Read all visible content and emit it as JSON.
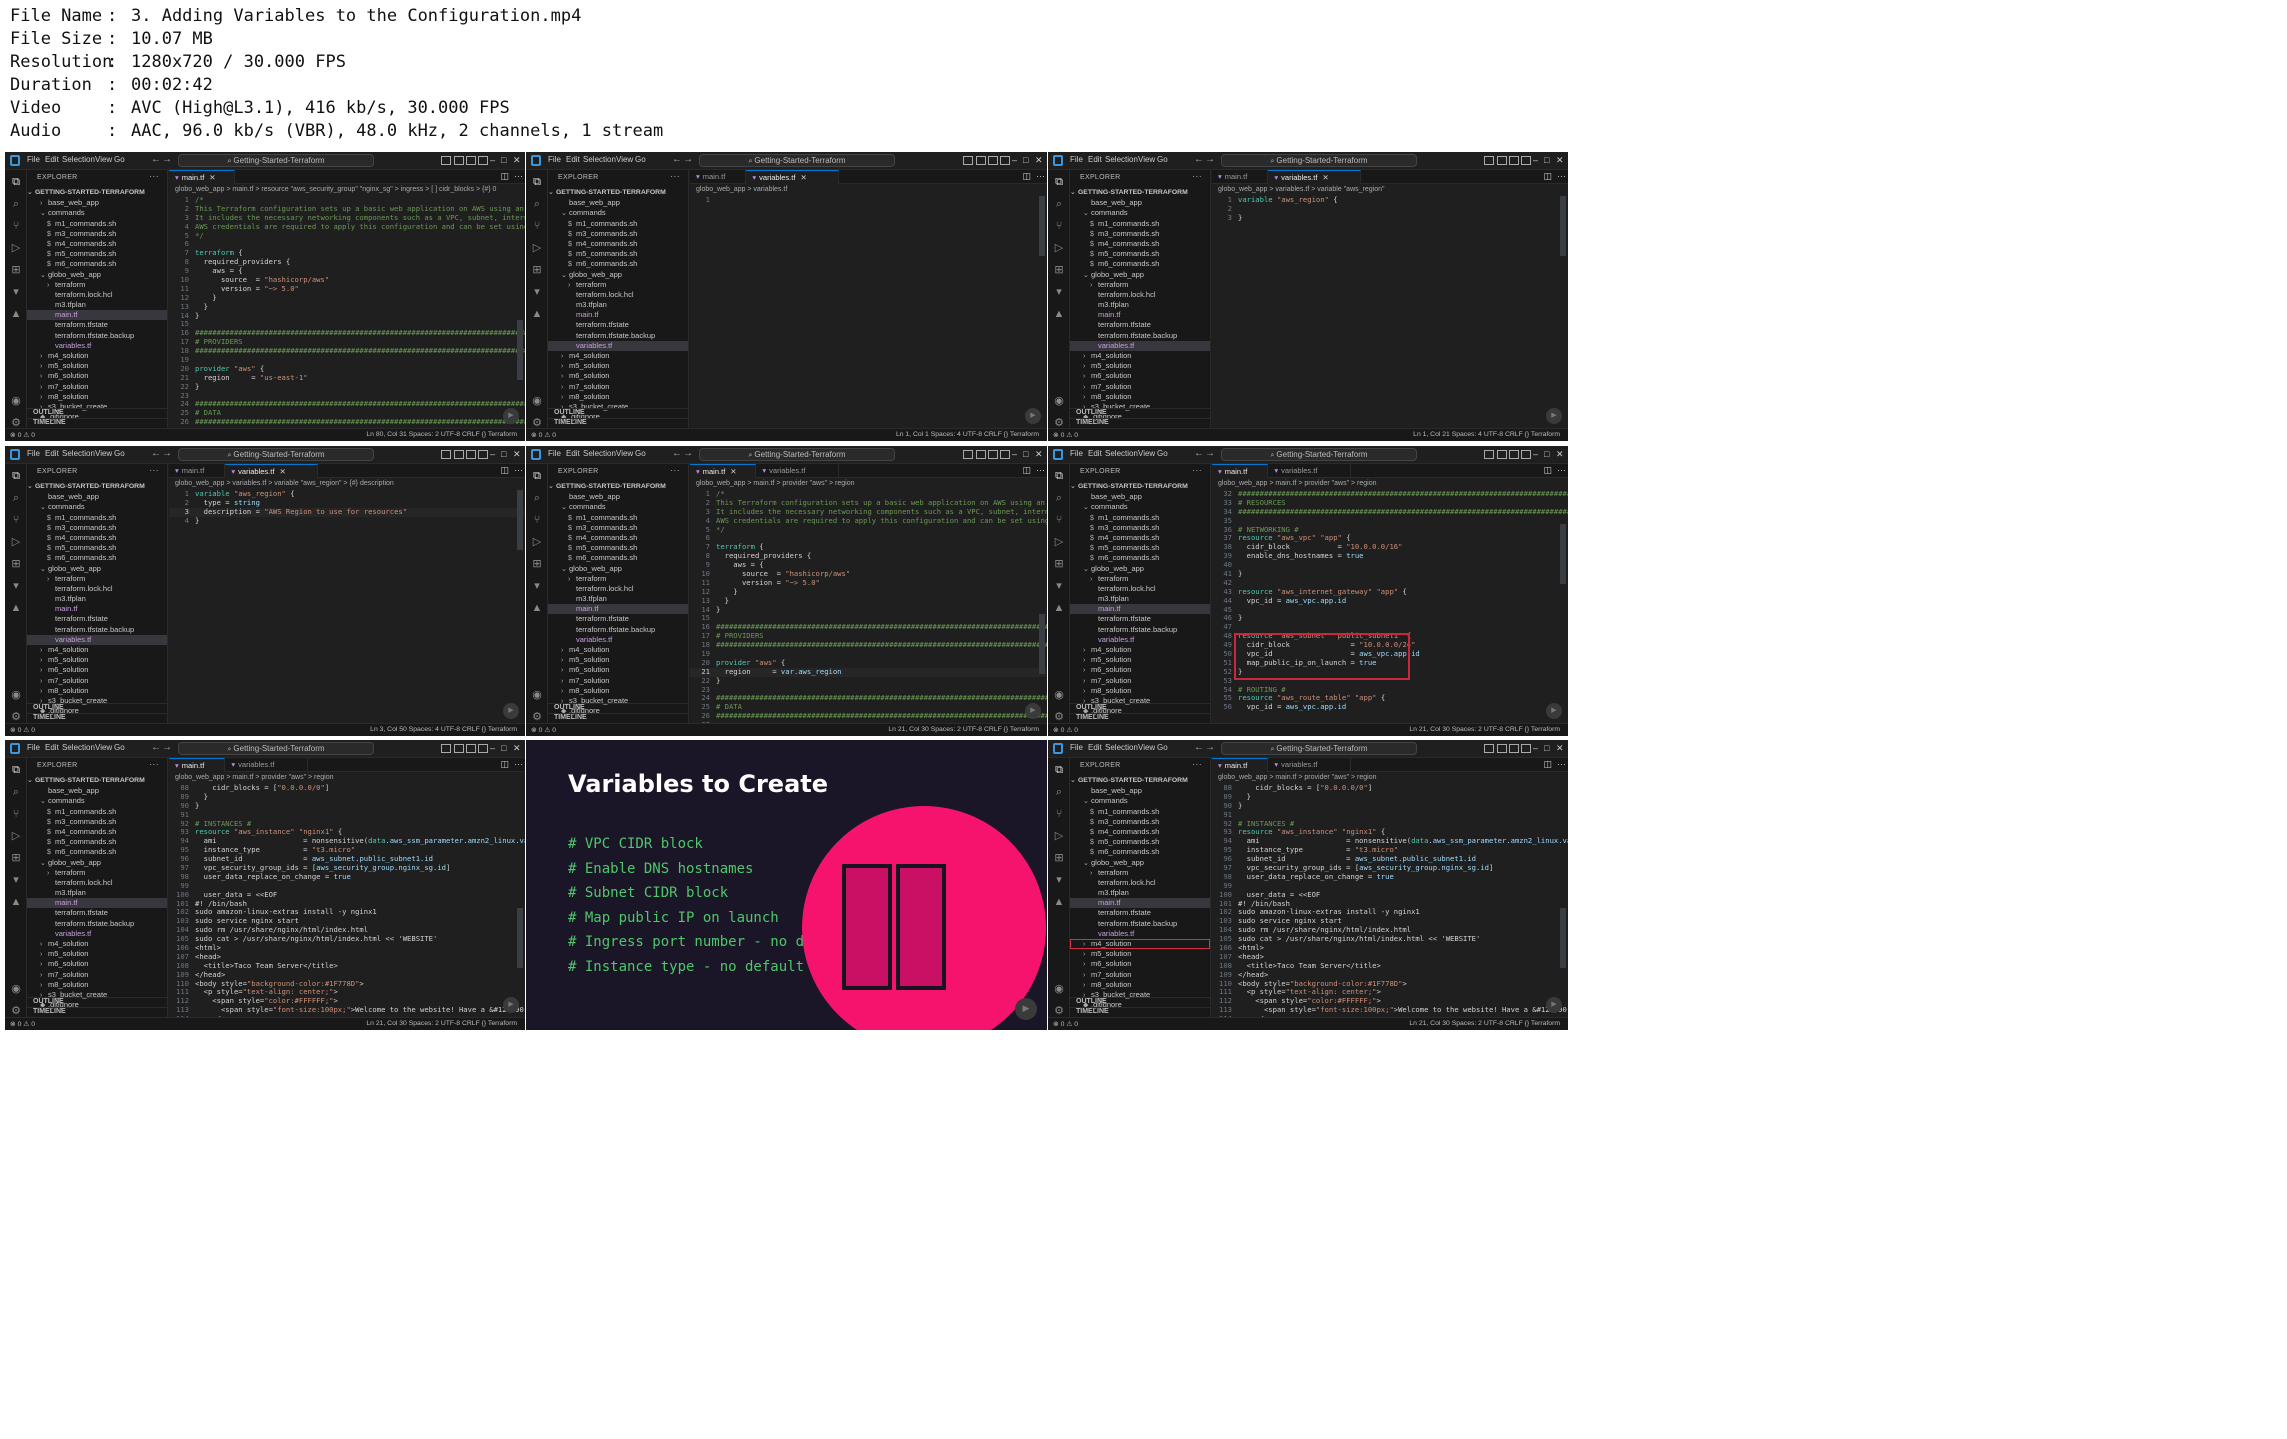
{
  "meta": [
    {
      "key": "File Name",
      "value": "3. Adding Variables to the Configuration.mp4"
    },
    {
      "key": "File Size",
      "value": "10.07 MB"
    },
    {
      "key": "Resolution",
      "value": "1280x720 / 30.000 FPS"
    },
    {
      "key": "Duration",
      "value": "00:02:42"
    },
    {
      "key": "Video",
      "value": "AVC (High@L3.1), 416 kb/s, 30.000 FPS"
    },
    {
      "key": "Audio",
      "value": "AAC, 96.0 kb/s (VBR), 48.0 kHz, 2 channels, 1 stream"
    }
  ],
  "ui": {
    "menu": [
      "File",
      "Edit",
      "Selection",
      "View",
      "Go"
    ],
    "search": "Getting-Started-Terraform",
    "explorer": "EXPLORER",
    "root": "GETTING-STARTED-TERRAFORM",
    "outline": "OUTLINE",
    "timeline": "TIMELINE"
  },
  "colors": {
    "accent": "#0078d4",
    "pink": "#f5136e",
    "highlight": "#c8283c",
    "slide_bg": "#1a1628",
    "slide_code": "#4fc66a"
  },
  "frames": [
    {
      "tabs": [
        {
          "label": "main.tf",
          "active": true,
          "close": true
        }
      ],
      "breadcrumb": "globo_web_app > main.tf > resource \"aws_security_group\" \"nginx_sg\" > ingress > [ ] cidr_blocks > {#} 0",
      "tree_top": "base_web_app",
      "tree_top_chev": "›",
      "tree_state": "main",
      "lines": [
        {
          "n": "1",
          "t": "/*"
        },
        {
          "n": "2",
          "t": "This Terraform configuration sets up a basic web application on AWS using an EC2 instance"
        },
        {
          "n": "3",
          "t": "It includes the necessary networking components such as a VPC, subnet, internet gateway, a"
        },
        {
          "n": "4",
          "t": "AWS credentials are required to apply this configuration and can be set using environment"
        },
        {
          "n": "5",
          "t": "*/"
        },
        {
          "n": "6",
          "t": ""
        },
        {
          "n": "7",
          "t": "terraform {"
        },
        {
          "n": "8",
          "t": "  required_providers {"
        },
        {
          "n": "9",
          "t": "    aws = {"
        },
        {
          "n": "10",
          "t": "      source  = \"hashicorp/aws\""
        },
        {
          "n": "11",
          "t": "      version = \"~> 5.0\""
        },
        {
          "n": "12",
          "t": "    }"
        },
        {
          "n": "13",
          "t": "  }"
        },
        {
          "n": "14",
          "t": "}"
        },
        {
          "n": "15",
          "t": ""
        },
        {
          "n": "16",
          "t": "##################################################################################"
        },
        {
          "n": "17",
          "t": "# PROVIDERS"
        },
        {
          "n": "18",
          "t": "##################################################################################"
        },
        {
          "n": "19",
          "t": ""
        },
        {
          "n": "20",
          "t": "provider \"aws\" {"
        },
        {
          "n": "21",
          "t": "  region     = \"us-east-1\""
        },
        {
          "n": "22",
          "t": "}"
        },
        {
          "n": "23",
          "t": ""
        },
        {
          "n": "24",
          "t": "##################################################################################"
        },
        {
          "n": "25",
          "t": "# DATA"
        },
        {
          "n": "26",
          "t": "##################################################################################"
        }
      ],
      "status": "Ln 80, Col 31   Spaces: 2   UTF-8   CRLF   {} Terraform"
    },
    {
      "tabs": [
        {
          "label": "main.tf",
          "active": false,
          "close": false
        },
        {
          "label": "variables.tf",
          "active": true,
          "close": true
        }
      ],
      "breadcrumb": "globo_web_app > variables.tf",
      "tree_top": "base_web_app",
      "tree_top_chev": "",
      "tree_state": "variables",
      "lines": [
        {
          "n": "1",
          "t": ""
        }
      ],
      "status": "Ln 1, Col 1   Spaces: 4   UTF-8   CRLF   {} Terraform"
    },
    {
      "tabs": [
        {
          "label": "main.tf",
          "active": false,
          "close": false
        },
        {
          "label": "variables.tf",
          "active": true,
          "close": true
        }
      ],
      "breadcrumb": "globo_web_app > variables.tf > variable \"aws_region\"",
      "tree_top": "base_web_app",
      "tree_top_chev": "",
      "tree_state": "variables",
      "lines": [
        {
          "n": "1",
          "t": "variable \"aws_region\" {"
        },
        {
          "n": "2",
          "t": ""
        },
        {
          "n": "3",
          "t": "}"
        }
      ],
      "status": "Ln 1, Col 21   Spaces: 4   UTF-8   CRLF   {} Terraform"
    },
    {
      "tabs": [
        {
          "label": "main.tf",
          "active": false,
          "close": false
        },
        {
          "label": "variables.tf",
          "active": true,
          "close": true
        }
      ],
      "breadcrumb": "globo_web_app > variables.tf > variable \"aws_region\" > {#} description",
      "tree_top": "base_web_app",
      "tree_top_chev": "",
      "tree_state": "variables",
      "lines": [
        {
          "n": "1",
          "t": "variable \"aws_region\" {"
        },
        {
          "n": "2",
          "t": "  type = string"
        },
        {
          "n": "3",
          "t": "  description = \"AWS Region to use for resources\""
        },
        {
          "n": "4",
          "t": "}"
        }
      ],
      "status": "Ln 3, Col 50   Spaces: 4   UTF-8   CRLF   {} Terraform"
    },
    {
      "tabs": [
        {
          "label": "main.tf",
          "active": true,
          "close": true
        },
        {
          "label": "variables.tf",
          "active": false,
          "close": false
        }
      ],
      "breadcrumb": "globo_web_app > main.tf > provider \"aws\" > region",
      "tree_top": "base_web_app",
      "tree_top_chev": "",
      "tree_state": "main",
      "lines": [
        {
          "n": "1",
          "t": "/*"
        },
        {
          "n": "2",
          "t": "This Terraform configuration sets up a basic web application on AWS using an EC2 instance"
        },
        {
          "n": "3",
          "t": "It includes the necessary networking components such as a VPC, subnet, internet gateway, an"
        },
        {
          "n": "4",
          "t": "AWS credentials are required to apply this configuration and can be set using environment"
        },
        {
          "n": "5",
          "t": "*/"
        },
        {
          "n": "6",
          "t": ""
        },
        {
          "n": "7",
          "t": "terraform {"
        },
        {
          "n": "8",
          "t": "  required_providers {"
        },
        {
          "n": "9",
          "t": "    aws = {"
        },
        {
          "n": "10",
          "t": "      source  = \"hashicorp/aws\""
        },
        {
          "n": "11",
          "t": "      version = \"~> 5.0\""
        },
        {
          "n": "12",
          "t": "    }"
        },
        {
          "n": "13",
          "t": "  }"
        },
        {
          "n": "14",
          "t": "}"
        },
        {
          "n": "15",
          "t": ""
        },
        {
          "n": "16",
          "t": "##################################################################################"
        },
        {
          "n": "17",
          "t": "# PROVIDERS"
        },
        {
          "n": "18",
          "t": "##################################################################################"
        },
        {
          "n": "19",
          "t": ""
        },
        {
          "n": "20",
          "t": "provider \"aws\" {"
        },
        {
          "n": "21",
          "t": "  region     = var.aws_region"
        },
        {
          "n": "22",
          "t": "}"
        },
        {
          "n": "23",
          "t": ""
        },
        {
          "n": "24",
          "t": "##################################################################################"
        },
        {
          "n": "25",
          "t": "# DATA"
        },
        {
          "n": "26",
          "t": "##################################################################################"
        },
        {
          "n": "27",
          "t": ""
        }
      ],
      "status": "Ln 21, Col 30   Spaces: 2   UTF-8   CRLF   {} Terraform"
    },
    {
      "tabs": [
        {
          "label": "main.tf",
          "active": true,
          "close": false
        },
        {
          "label": "variables.tf",
          "active": false,
          "close": false
        }
      ],
      "breadcrumb": "globo_web_app > main.tf > provider \"aws\" > region",
      "tree_top": "base_web_app",
      "tree_top_chev": "",
      "tree_state": "main",
      "lines": [
        {
          "n": "32",
          "t": "##################################################################################"
        },
        {
          "n": "33",
          "t": "# RESOURCES"
        },
        {
          "n": "34",
          "t": "##################################################################################"
        },
        {
          "n": "35",
          "t": ""
        },
        {
          "n": "36",
          "t": "# NETWORKING #"
        },
        {
          "n": "37",
          "t": "resource \"aws_vpc\" \"app\" {"
        },
        {
          "n": "38",
          "t": "  cidr_block           = \"10.0.0.0/16\""
        },
        {
          "n": "39",
          "t": "  enable_dns_hostnames = true"
        },
        {
          "n": "40",
          "t": ""
        },
        {
          "n": "41",
          "t": "}"
        },
        {
          "n": "42",
          "t": ""
        },
        {
          "n": "43",
          "t": "resource \"aws_internet_gateway\" \"app\" {"
        },
        {
          "n": "44",
          "t": "  vpc_id = aws_vpc.app.id"
        },
        {
          "n": "45",
          "t": ""
        },
        {
          "n": "46",
          "t": "}"
        },
        {
          "n": "47",
          "t": ""
        },
        {
          "n": "48",
          "t": "resource \"aws_subnet\" \"public_subnet1\" {"
        },
        {
          "n": "49",
          "t": "  cidr_block              = \"10.0.0.0/24\""
        },
        {
          "n": "50",
          "t": "  vpc_id                  = aws_vpc.app.id"
        },
        {
          "n": "51",
          "t": "  map_public_ip_on_launch = true"
        },
        {
          "n": "52",
          "t": "}"
        },
        {
          "n": "53",
          "t": ""
        },
        {
          "n": "54",
          "t": "# ROUTING #"
        },
        {
          "n": "55",
          "t": "resource \"aws_route_table\" \"app\" {"
        },
        {
          "n": "56",
          "t": "  vpc_id = aws_vpc.app.id"
        }
      ],
      "status": "Ln 21, Col 30   Spaces: 2   UTF-8   CRLF   {} Terraform"
    },
    {
      "tabs": [
        {
          "label": "main.tf",
          "active": true,
          "close": false
        },
        {
          "label": "variables.tf",
          "active": false,
          "close": false
        }
      ],
      "breadcrumb": "globo_web_app > main.tf > provider \"aws\" > region",
      "tree_top": "base_web_app",
      "tree_top_chev": "",
      "tree_state": "main",
      "lines": [
        {
          "n": "88",
          "t": "    cidr_blocks = [\"0.0.0.0/0\"]"
        },
        {
          "n": "89",
          "t": "  }"
        },
        {
          "n": "90",
          "t": "}"
        },
        {
          "n": "91",
          "t": ""
        },
        {
          "n": "92",
          "t": "# INSTANCES #"
        },
        {
          "n": "93",
          "t": "resource \"aws_instance\" \"nginx1\" {"
        },
        {
          "n": "94",
          "t": "  ami                    = nonsensitive(data.aws_ssm_parameter.amzn2_linux.value)"
        },
        {
          "n": "95",
          "t": "  instance_type          = \"t3.micro\""
        },
        {
          "n": "96",
          "t": "  subnet_id              = aws_subnet.public_subnet1.id"
        },
        {
          "n": "97",
          "t": "  vpc_security_group_ids = [aws_security_group.nginx_sg.id]"
        },
        {
          "n": "98",
          "t": "  user_data_replace_on_change = true"
        },
        {
          "n": "99",
          "t": ""
        },
        {
          "n": "100",
          "t": "  user_data = <<EOF"
        },
        {
          "n": "101",
          "t": "#! /bin/bash"
        },
        {
          "n": "102",
          "t": "sudo amazon-linux-extras install -y nginx1"
        },
        {
          "n": "103",
          "t": "sudo service nginx start"
        },
        {
          "n": "104",
          "t": "sudo rm /usr/share/nginx/html/index.html"
        },
        {
          "n": "105",
          "t": "sudo cat > /usr/share/nginx/html/index.html << 'WEBSITE'"
        },
        {
          "n": "106",
          "t": "<html>"
        },
        {
          "n": "107",
          "t": "<head>"
        },
        {
          "n": "108",
          "t": "  <title>Taco Team Server</title>"
        },
        {
          "n": "109",
          "t": "</head>"
        },
        {
          "n": "110",
          "t": "<body style=\"background-color:#1F778D\">"
        },
        {
          "n": "111",
          "t": "  <p style=\"text-align: center;\">"
        },
        {
          "n": "112",
          "t": "    <span style=\"color:#FFFFFF;\">"
        },
        {
          "n": "113",
          "t": "      <span style=\"font-size:100px;\">Welcome to the website! Have a &#127790;</span>"
        },
        {
          "n": "114",
          "t": "    </span>"
        }
      ],
      "status": "Ln 21, Col 30   Spaces: 2   UTF-8   CRLF   {} Terraform"
    },
    {
      "tabs": [
        {
          "label": "main.tf",
          "active": true,
          "close": false
        },
        {
          "label": "variables.tf",
          "active": false,
          "close": false
        }
      ],
      "breadcrumb": "globo_web_app > main.tf > provider \"aws\" > region",
      "tree_top": "base_web_app",
      "tree_top_chev": "",
      "tree_state": "main",
      "lines": [
        {
          "n": "88",
          "t": "    cidr_blocks = [\"0.0.0.0/0\"]"
        },
        {
          "n": "89",
          "t": "  }"
        },
        {
          "n": "90",
          "t": "}"
        },
        {
          "n": "91",
          "t": ""
        },
        {
          "n": "92",
          "t": "# INSTANCES #"
        },
        {
          "n": "93",
          "t": "resource \"aws_instance\" \"nginx1\" {"
        },
        {
          "n": "94",
          "t": "  ami                    = nonsensitive(data.aws_ssm_parameter.amzn2_linux.value)"
        },
        {
          "n": "95",
          "t": "  instance_type          = \"t3.micro\""
        },
        {
          "n": "96",
          "t": "  subnet_id              = aws_subnet.public_subnet1.id"
        },
        {
          "n": "97",
          "t": "  vpc_security_group_ids = [aws_security_group.nginx_sg.id]"
        },
        {
          "n": "98",
          "t": "  user_data_replace_on_change = true"
        },
        {
          "n": "99",
          "t": ""
        },
        {
          "n": "100",
          "t": "  user_data = <<EOF"
        },
        {
          "n": "101",
          "t": "#! /bin/bash"
        },
        {
          "n": "102",
          "t": "sudo amazon-linux-extras install -y nginx1"
        },
        {
          "n": "103",
          "t": "sudo service nginx start"
        },
        {
          "n": "104",
          "t": "sudo rm /usr/share/nginx/html/index.html"
        },
        {
          "n": "105",
          "t": "sudo cat > /usr/share/nginx/html/index.html << 'WEBSITE'"
        },
        {
          "n": "106",
          "t": "<html>"
        },
        {
          "n": "107",
          "t": "<head>"
        },
        {
          "n": "108",
          "t": "  <title>Taco Team Server</title>"
        },
        {
          "n": "109",
          "t": "</head>"
        },
        {
          "n": "110",
          "t": "<body style=\"background-color:#1F778D\">"
        },
        {
          "n": "111",
          "t": "  <p style=\"text-align: center;\">"
        },
        {
          "n": "112",
          "t": "    <span style=\"color:#FFFFFF;\">"
        },
        {
          "n": "113",
          "t": "      <span style=\"font-size:100px;\">Welcome to the website! Have a &#127790;</span>"
        },
        {
          "n": "114",
          "t": "    </span>"
        }
      ],
      "status": "Ln 21, Col 30   Spaces: 2   UTF-8   CRLF   {} Terraform"
    }
  ],
  "tree": {
    "commands": [
      "m1_commands.sh",
      "m3_commands.sh",
      "m4_commands.sh",
      "m5_commands.sh",
      "m6_commands.sh"
    ],
    "globo": [
      "terraform",
      "terraform.lock.hcl",
      "m3.tfplan",
      "main.tf",
      "terraform.tfstate",
      "terraform.tfstate.backup",
      "variables.tf"
    ],
    "after": [
      "m4_solution",
      "m5_solution",
      "m6_solution",
      "m7_solution",
      "m8_solution",
      "s3_bucket_create"
    ],
    "gitignore": ".gitignore",
    "commands_folder": "commands",
    "globo_folder": "globo_web_app"
  },
  "slide": {
    "title": "Variables to Create",
    "items": [
      "# VPC CIDR block",
      "# Enable DNS hostnames",
      "# Subnet CIDR block",
      "# Map public IP on launch",
      "# Ingress port number - no default",
      "# Instance type - no default"
    ]
  },
  "statusbar_left": "⊗ 0 ⚠ 0"
}
